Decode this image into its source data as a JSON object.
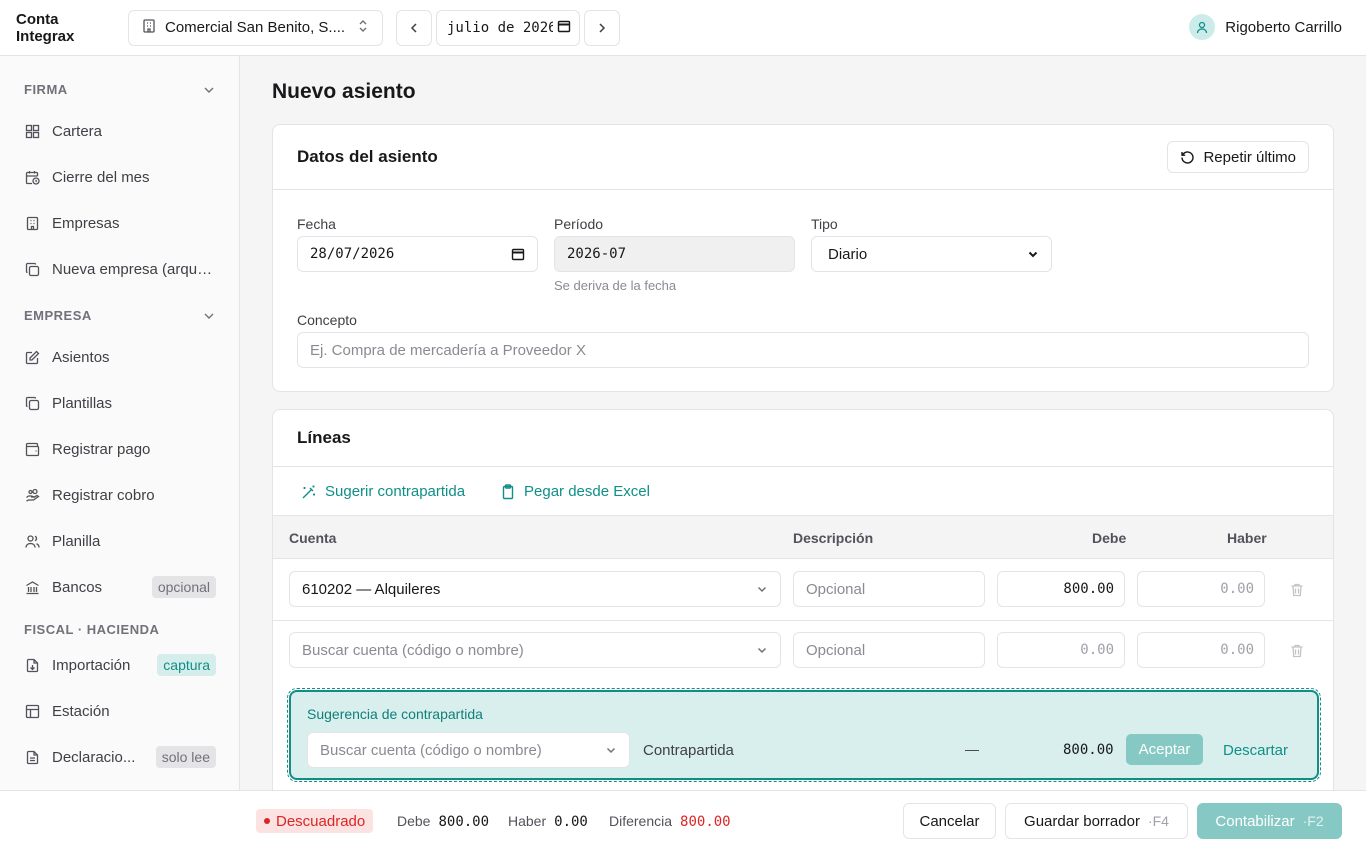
{
  "app": {
    "brand": "Conta Integrax"
  },
  "header": {
    "company": "Comercial San Benito, S....",
    "month": "julio de 2026",
    "user_name": "Rigoberto Carrillo"
  },
  "sidebar": {
    "firma": {
      "title": "FIRMA",
      "items": [
        {
          "label": "Cartera",
          "icon": "grid-icon"
        },
        {
          "label": "Cierre del mes",
          "icon": "calendar-clock-icon"
        },
        {
          "label": "Empresas",
          "icon": "building-icon"
        },
        {
          "label": "Nueva empresa (arque...",
          "icon": "copy-icon"
        }
      ]
    },
    "empresa": {
      "title": "EMPRESA",
      "items": [
        {
          "label": "Asientos",
          "icon": "edit-icon"
        },
        {
          "label": "Plantillas",
          "icon": "copy-icon"
        },
        {
          "label": "Registrar pago",
          "icon": "wallet-icon"
        },
        {
          "label": "Registrar cobro",
          "icon": "hand-coins-icon"
        },
        {
          "label": "Planilla",
          "icon": "users-icon"
        },
        {
          "label": "Bancos",
          "icon": "bank-icon",
          "badge": "opcional"
        }
      ]
    },
    "fiscal": {
      "title": "FISCAL · HACIENDA",
      "items": [
        {
          "label": "Importación",
          "icon": "file-import-icon",
          "badge": "captura"
        },
        {
          "label": "Estación",
          "icon": "table-icon"
        },
        {
          "label": "Declaracio...",
          "icon": "file-text-icon",
          "badge": "solo lee"
        }
      ]
    }
  },
  "main": {
    "title": "Nuevo asiento",
    "datos": {
      "title": "Datos del asiento",
      "repeat_label": "Repetir último",
      "fecha_label": "Fecha",
      "fecha_value": "28/07/2026",
      "periodo_label": "Período",
      "periodo_value": "2026-07",
      "periodo_hint": "Se deriva de la fecha",
      "tipo_label": "Tipo",
      "tipo_value": "Diario",
      "concepto_label": "Concepto",
      "concepto_placeholder": "Ej. Compra de mercadería a Proveedor X"
    },
    "lineas": {
      "title": "Líneas",
      "suggest_label": "Sugerir contrapartida",
      "paste_label": "Pegar desde Excel",
      "columns": {
        "cuenta": "Cuenta",
        "descripcion": "Descripción",
        "debe": "Debe",
        "haber": "Haber"
      },
      "rows": [
        {
          "cuenta": "610202 — Alquileres",
          "descripcion_placeholder": "Opcional",
          "debe": "800.00",
          "haber": "0.00"
        },
        {
          "cuenta_placeholder": "Buscar cuenta (código o nombre)",
          "descripcion_placeholder": "Opcional",
          "debe": "0.00",
          "haber": "0.00"
        }
      ],
      "suggestion": {
        "title": "Sugerencia de contrapartida",
        "cuenta_placeholder": "Buscar cuenta (código o nombre)",
        "descripcion": "Contrapartida",
        "debe": "—",
        "haber": "800.00",
        "accept_label": "Aceptar",
        "discard_label": "Descartar"
      }
    }
  },
  "footer": {
    "status": "Descuadrado",
    "debe_label": "Debe",
    "debe_value": "800.00",
    "haber_label": "Haber",
    "haber_value": "0.00",
    "diff_label": "Diferencia",
    "diff_value": "800.00",
    "cancel_label": "Cancelar",
    "draft_label": "Guardar borrador",
    "draft_kbd": "·F4",
    "post_label": "Contabilizar",
    "post_kbd": "·F2"
  },
  "colors": {
    "accent": "#0f8f88",
    "accent_light": "#86c9c4",
    "danger": "#dc2626"
  }
}
